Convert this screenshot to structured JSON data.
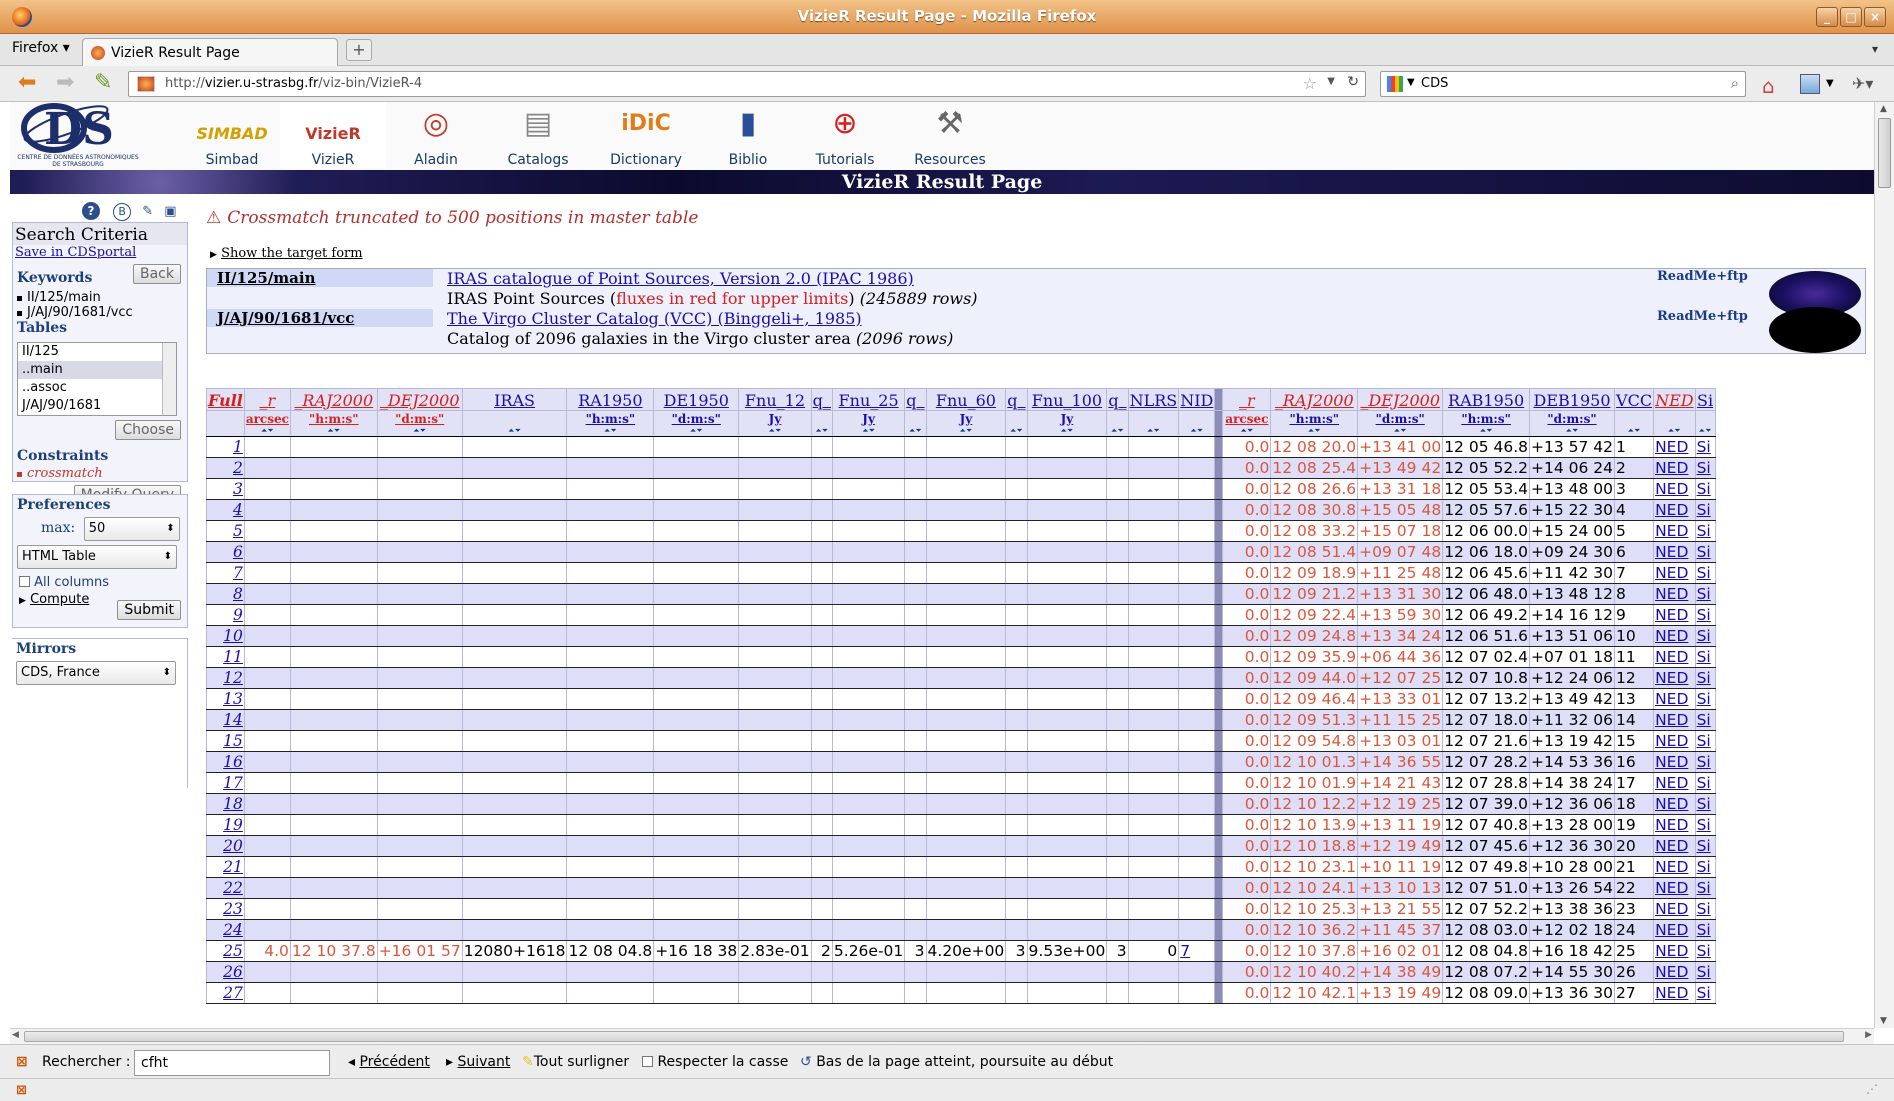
{
  "window": {
    "title": "VizieR Result Page - Mozilla Firefox",
    "firefox_menu": "Firefox",
    "tab_title": "VizieR Result Page",
    "url_prefix": "http://",
    "url_host": "vizier.u-strasbg.fr",
    "url_path": "/viz-bin/VizieR-4",
    "search_engine_text": "CDS"
  },
  "portals": [
    {
      "label": "Simbad",
      "icon": "simbad-icon"
    },
    {
      "label": "VizieR",
      "icon": "vizier-icon"
    },
    {
      "label": "Aladin",
      "icon": "aladin-icon"
    },
    {
      "label": "Catalogs",
      "icon": "catalogs-icon"
    },
    {
      "label": "Dictionary",
      "icon": "dictionary-icon"
    },
    {
      "label": "Biblio",
      "icon": "biblio-icon"
    },
    {
      "label": "Tutorials",
      "icon": "tutorials-icon"
    },
    {
      "label": "Resources",
      "icon": "resources-icon"
    }
  ],
  "logo_text": "CENTRE DE DONNÉES ASTRONOMIQUES DE STRASBOURG",
  "page_title": "VizieR Result Page",
  "sidebar": {
    "search_criteria": "Search Criteria",
    "save_link": "Save in CDSportal",
    "keywords_label": "Keywords",
    "back_button": "Back",
    "keywords": [
      "II/125/main",
      "J/AJ/90/1681/vcc"
    ],
    "tables_label": "Tables",
    "tables_list": [
      "II/125",
      "..main",
      "..assoc",
      "J/AJ/90/1681"
    ],
    "choose_button": "Choose",
    "constraints_label": "Constraints",
    "constraint": "crossmatch",
    "modify_button": "Modify Query",
    "preferences_label": "Preferences",
    "max_label": "max:",
    "max_value": "50",
    "format_value": "HTML Table",
    "all_columns": "All columns",
    "compute": "Compute",
    "submit_button": "Submit",
    "mirrors_label": "Mirrors",
    "mirror_value": "CDS, France"
  },
  "main": {
    "warning": "Crossmatch truncated to 500 positions in master table",
    "show_target": "Show the target form",
    "catalogs": [
      {
        "id": "II/125/main",
        "title": "IRAS catalogue of Point Sources, Version 2.0 (IPAC 1986)",
        "desc_prefix": "IRAS Point Sources (",
        "desc_red": "fluxes in red for upper limits",
        "desc_suffix": ")",
        "rows": "(245889 rows)",
        "readme": "ReadMe+ftp"
      },
      {
        "id": "J/AJ/90/1681/vcc",
        "title": "The Virgo Cluster Catalog (VCC) (Binggeli+, 1985)",
        "desc_prefix": "Catalog of 2096 galaxies in the Virgo cluster area",
        "desc_red": "",
        "desc_suffix": "",
        "rows": "(2096 rows)",
        "readme": "ReadMe+ftp"
      }
    ]
  },
  "table": {
    "headers_left": [
      "Full",
      "_r",
      "_RAJ2000",
      "_DEJ2000",
      "IRAS",
      "RA1950",
      "DE1950",
      "Fnu_12",
      "q_",
      "Fnu_25",
      "q_",
      "Fnu_60",
      "q_",
      "Fnu_100",
      "q_",
      "NLRS",
      "NID"
    ],
    "units_left": [
      "",
      "arcsec",
      "\"h:m:s\"",
      "\"d:m:s\"",
      "",
      "\"h:m:s\"",
      "\"d:m:s\"",
      "Jy",
      "",
      "Jy",
      "",
      "Jy",
      "",
      "Jy",
      "",
      "",
      ""
    ],
    "headers_right": [
      "_r",
      "_RAJ2000",
      "_DEJ2000",
      "RAB1950",
      "DEB1950",
      "VCC",
      "NED",
      "Si"
    ],
    "units_right": [
      "arcsec",
      "\"h:m:s\"",
      "\"d:m:s\"",
      "\"h:m:s\"",
      "\"d:m:s\"",
      "",
      "",
      ""
    ],
    "iras_row_25": [
      "4.0",
      "12 10 37.8",
      "+16 01 57",
      "12080+1618",
      "12 08 04.8",
      "+16 18 38",
      "2.83e-01",
      "2",
      "5.26e-01",
      "3",
      "4.20e+00",
      "3",
      "9.53e+00",
      "3",
      "0",
      "7"
    ],
    "rows": [
      [
        "1",
        "0.0",
        "12 08 20.0",
        "+13 41 00",
        "12 05 46.8",
        "+13 57 42",
        "1"
      ],
      [
        "2",
        "0.0",
        "12 08 25.4",
        "+13 49 42",
        "12 05 52.2",
        "+14 06 24",
        "2"
      ],
      [
        "3",
        "0.0",
        "12 08 26.6",
        "+13 31 18",
        "12 05 53.4",
        "+13 48 00",
        "3"
      ],
      [
        "4",
        "0.0",
        "12 08 30.8",
        "+15 05 48",
        "12 05 57.6",
        "+15 22 30",
        "4"
      ],
      [
        "5",
        "0.0",
        "12 08 33.2",
        "+15 07 18",
        "12 06 00.0",
        "+15 24 00",
        "5"
      ],
      [
        "6",
        "0.0",
        "12 08 51.4",
        "+09 07 48",
        "12 06 18.0",
        "+09 24 30",
        "6"
      ],
      [
        "7",
        "0.0",
        "12 09 18.9",
        "+11 25 48",
        "12 06 45.6",
        "+11 42 30",
        "7"
      ],
      [
        "8",
        "0.0",
        "12 09 21.2",
        "+13 31 30",
        "12 06 48.0",
        "+13 48 12",
        "8"
      ],
      [
        "9",
        "0.0",
        "12 09 22.4",
        "+13 59 30",
        "12 06 49.2",
        "+14 16 12",
        "9"
      ],
      [
        "10",
        "0.0",
        "12 09 24.8",
        "+13 34 24",
        "12 06 51.6",
        "+13 51 06",
        "10"
      ],
      [
        "11",
        "0.0",
        "12 09 35.9",
        "+06 44 36",
        "12 07 02.4",
        "+07 01 18",
        "11"
      ],
      [
        "12",
        "0.0",
        "12 09 44.0",
        "+12 07 25",
        "12 07 10.8",
        "+12 24 06",
        "12"
      ],
      [
        "13",
        "0.0",
        "12 09 46.4",
        "+13 33 01",
        "12 07 13.2",
        "+13 49 42",
        "13"
      ],
      [
        "14",
        "0.0",
        "12 09 51.3",
        "+11 15 25",
        "12 07 18.0",
        "+11 32 06",
        "14"
      ],
      [
        "15",
        "0.0",
        "12 09 54.8",
        "+13 03 01",
        "12 07 21.6",
        "+13 19 42",
        "15"
      ],
      [
        "16",
        "0.0",
        "12 10 01.3",
        "+14 36 55",
        "12 07 28.2",
        "+14 53 36",
        "16"
      ],
      [
        "17",
        "0.0",
        "12 10 01.9",
        "+14 21 43",
        "12 07 28.8",
        "+14 38 24",
        "17"
      ],
      [
        "18",
        "0.0",
        "12 10 12.2",
        "+12 19 25",
        "12 07 39.0",
        "+12 36 06",
        "18"
      ],
      [
        "19",
        "0.0",
        "12 10 13.9",
        "+13 11 19",
        "12 07 40.8",
        "+13 28 00",
        "19"
      ],
      [
        "20",
        "0.0",
        "12 10 18.8",
        "+12 19 49",
        "12 07 45.6",
        "+12 36 30",
        "20"
      ],
      [
        "21",
        "0.0",
        "12 10 23.1",
        "+10 11 19",
        "12 07 49.8",
        "+10 28 00",
        "21"
      ],
      [
        "22",
        "0.0",
        "12 10 24.1",
        "+13 10 13",
        "12 07 51.0",
        "+13 26 54",
        "22"
      ],
      [
        "23",
        "0.0",
        "12 10 25.3",
        "+13 21 55",
        "12 07 52.2",
        "+13 38 36",
        "23"
      ],
      [
        "24",
        "0.0",
        "12 10 36.2",
        "+11 45 37",
        "12 08 03.0",
        "+12 02 18",
        "24"
      ],
      [
        "25",
        "0.0",
        "12 10 37.8",
        "+16 02 01",
        "12 08 04.8",
        "+16 18 42",
        "25"
      ],
      [
        "26",
        "0.0",
        "12 10 40.2",
        "+14 38 49",
        "12 08 07.2",
        "+14 55 30",
        "26"
      ],
      [
        "27",
        "0.0",
        "12 10 42.1",
        "+13 19 49",
        "12 08 09.0",
        "+13 36 30",
        "27"
      ]
    ],
    "ned_label": "NED",
    "si_label": "Si"
  },
  "findbar": {
    "label": "Rechercher :",
    "value": "cfht",
    "prev": "Précédent",
    "next": "Suivant",
    "highlight": "Tout surligner",
    "match_case": "Respecter la casse",
    "status": "Bas de la page atteint, poursuite au début"
  },
  "colors": {
    "accent_red": "#d62020",
    "link_blue": "#1a0dab",
    "row_alt": "#dedef8"
  }
}
